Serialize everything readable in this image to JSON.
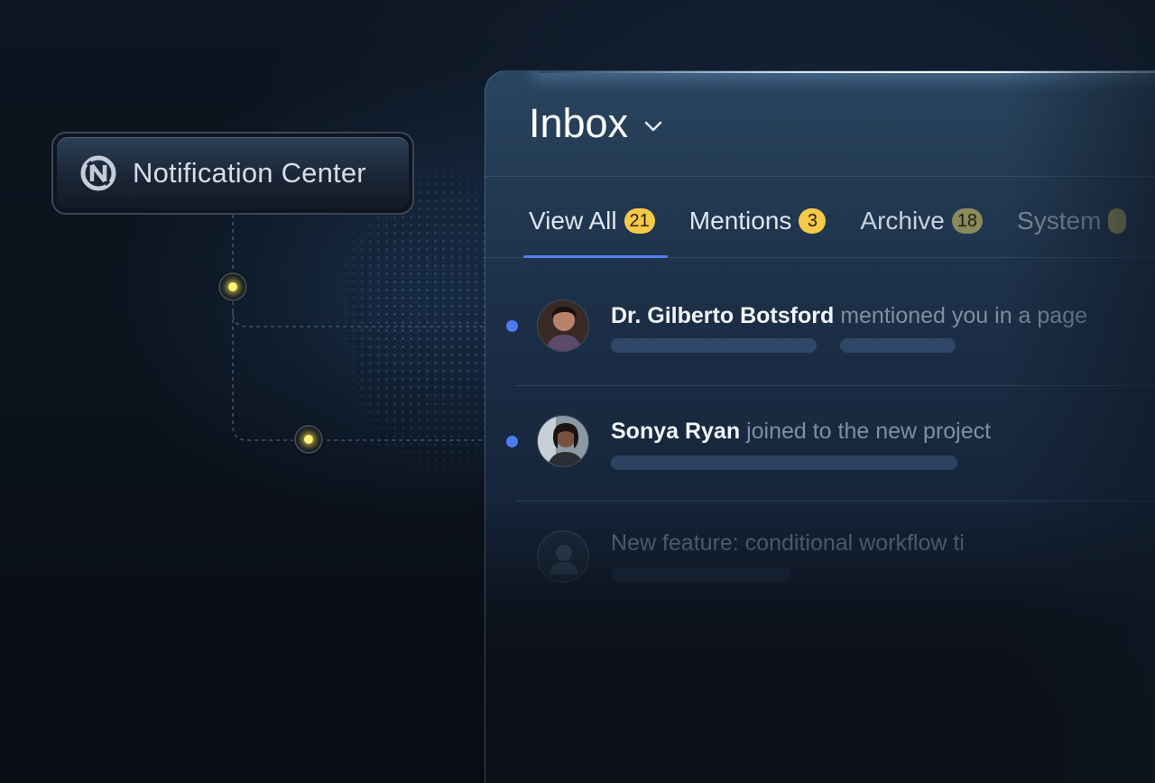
{
  "notification_center": {
    "label": "Notification Center",
    "logo_icon": "brand-logo-icon"
  },
  "inbox": {
    "title": "Inbox",
    "dropdown_icon": "chevron-down-icon"
  },
  "tabs": [
    {
      "label": "View All",
      "count": "21",
      "active": true
    },
    {
      "label": "Mentions",
      "count": "3",
      "active": false
    },
    {
      "label": "Archive",
      "count": "18",
      "active": false
    },
    {
      "label": "System",
      "count": "",
      "active": false
    }
  ],
  "notifications": [
    {
      "name": "Dr. Gilberto Botsford",
      "action": "mentioned you in a page",
      "unread": true
    },
    {
      "name": "Sonya Ryan",
      "action": "joined to the new project",
      "unread": true
    },
    {
      "name": "",
      "action": "New feature: conditional workflow ti",
      "unread": false
    }
  ],
  "colors": {
    "accent": "#4f7cf0",
    "badge": "#f7c948",
    "node_glow": "#fff27a",
    "unread_dot": "#4d7cf0"
  }
}
